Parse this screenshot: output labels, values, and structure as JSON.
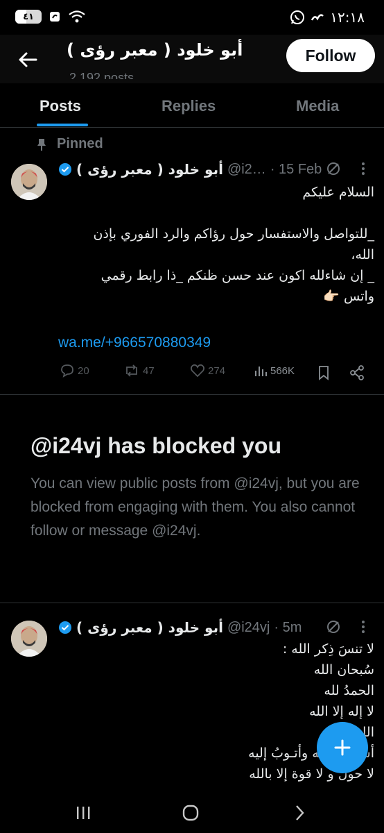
{
  "status_bar": {
    "battery": "٤١",
    "battery_level": 0.41,
    "time": "١٢:١٨"
  },
  "header": {
    "title": "أبو خلود ( معبر رؤى )",
    "post_count": "2,192 posts",
    "follow_label": "Follow"
  },
  "tabs": [
    {
      "label": "Posts",
      "active": true
    },
    {
      "label": "Replies",
      "active": false
    },
    {
      "label": "Media",
      "active": false
    }
  ],
  "pinned_label": "Pinned",
  "pinned_post": {
    "name": "أبو خلود ( معبر رؤى )",
    "handle": "@i2…",
    "time": "· 15 Feb",
    "lines": [
      "السلام عليكم",
      "",
      "_للتواصل والاستفسار حول رؤاكم والرد الفوري بإذن",
      "الله،",
      "_ إن شاءلله اكون عند حسن ظنكم _ذا رابط رقمي",
      "واتس 👉🏻"
    ],
    "link": "wa.me/+966570880349",
    "replies": "20",
    "reposts": "47",
    "likes": "274",
    "views": "566K"
  },
  "blocked": {
    "title": "@i24vj has blocked you",
    "description": "You can view public posts from @i24vj, but you are blocked from engaging with them. You also cannot follow or message @i24vj."
  },
  "second_post": {
    "name": "أبو خلود ( معبر رؤى )",
    "handle": "@i24vj",
    "time": "· 5m",
    "lines": [
      "لا تنسَ ذِكر الله :",
      "سُبحان الله",
      "الحمدُ لله",
      "لا إله إلا الله",
      "الله أكبر",
      "أستغفرُ الله وأتـوبُ إليه",
      "لا حول و لا قوة إلا بالله"
    ]
  },
  "colors": {
    "accent": "#1d9bf0",
    "background": "#000000",
    "muted": "#71767b"
  }
}
